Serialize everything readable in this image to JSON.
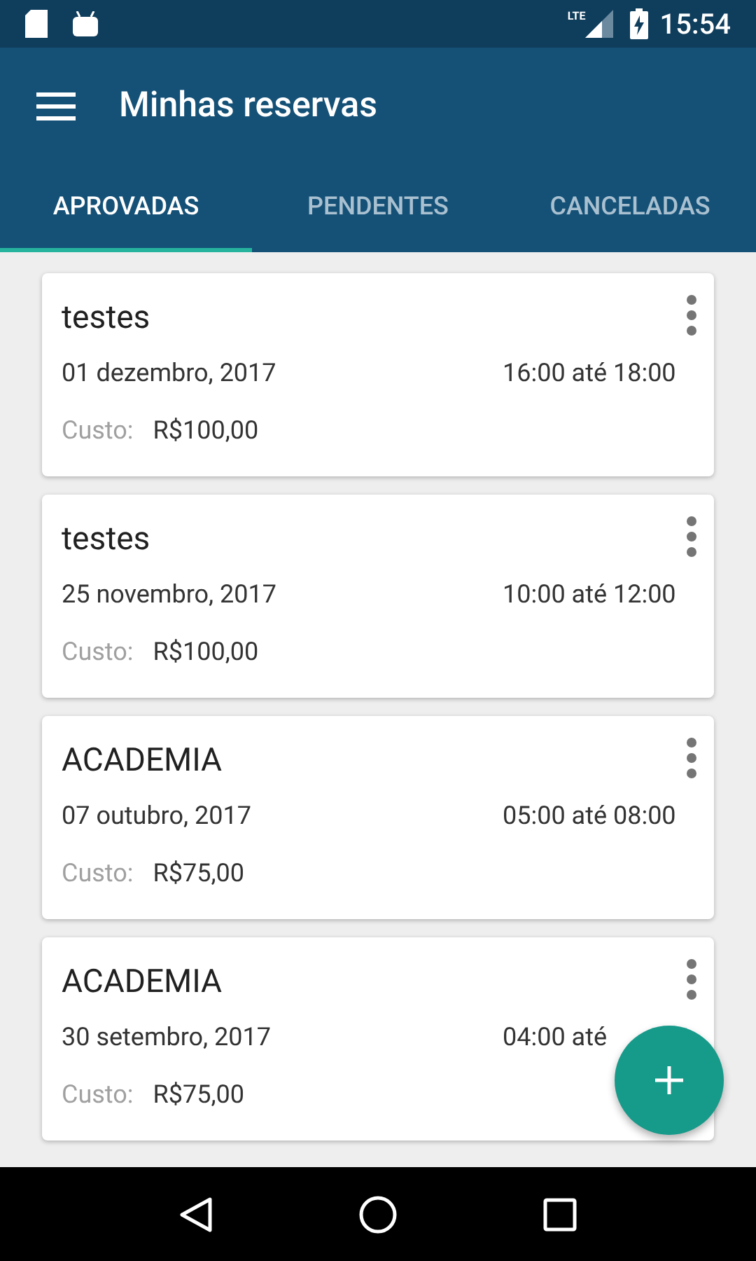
{
  "status_bar": {
    "time": "15:54",
    "network": "LTE"
  },
  "app_bar": {
    "title": "Minhas reservas"
  },
  "tabs": [
    {
      "label": "APROVADAS",
      "selected": true
    },
    {
      "label": "PENDENTES",
      "selected": false
    },
    {
      "label": "CANCELADAS",
      "selected": false
    }
  ],
  "reservations": [
    {
      "title": "testes",
      "date": "01 dezembro, 2017",
      "time": "16:00 até 18:00",
      "cost_label": "Custo:",
      "cost": "R$100,00"
    },
    {
      "title": "testes",
      "date": "25 novembro, 2017",
      "time": "10:00 até 12:00",
      "cost_label": "Custo:",
      "cost": "R$100,00"
    },
    {
      "title": "ACADEMIA",
      "date": "07 outubro, 2017",
      "time": "05:00 até 08:00",
      "cost_label": "Custo:",
      "cost": "R$75,00"
    },
    {
      "title": "ACADEMIA",
      "date": "30 setembro, 2017",
      "time": "04:00 até",
      "cost_label": "Custo:",
      "cost": "R$75,00"
    }
  ]
}
